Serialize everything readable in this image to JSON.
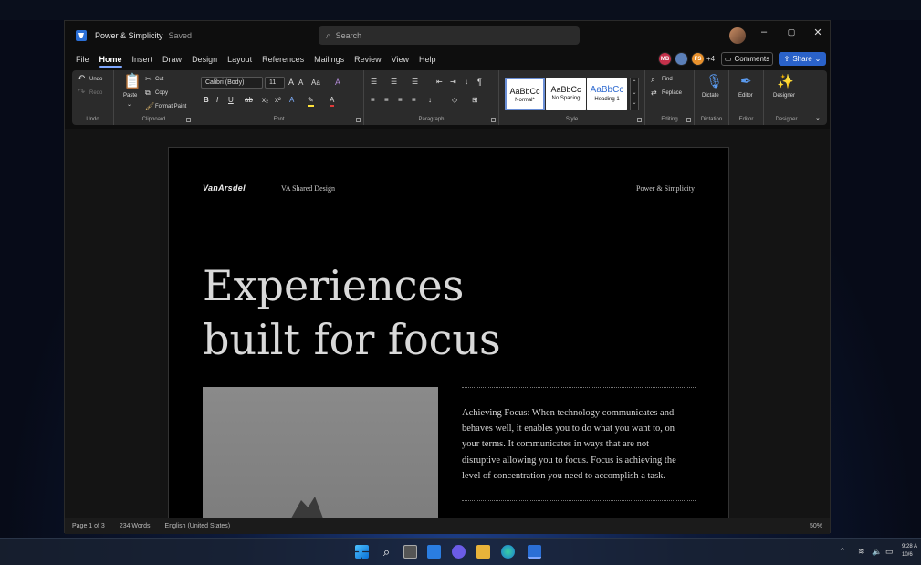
{
  "window": {
    "doc_title": "Power & Simplicity",
    "doc_status": "Saved",
    "search_placeholder": "Search"
  },
  "menu": {
    "tabs": [
      "File",
      "Home",
      "Insert",
      "Draw",
      "Design",
      "Layout",
      "References",
      "Mailings",
      "Review",
      "View",
      "Help"
    ],
    "active": "Home"
  },
  "collaborators": [
    {
      "initials": "MB",
      "color": "#c4314b"
    },
    {
      "initials": "",
      "color": "#5b7fb8"
    },
    {
      "initials": "FS",
      "color": "#e8912d"
    }
  ],
  "collab_more": "+4",
  "buttons": {
    "comments": "Comments",
    "share": "Share"
  },
  "ribbon": {
    "undo": {
      "undo": "Undo",
      "redo": "Redo",
      "label": "Undo"
    },
    "clipboard": {
      "paste": "Paste",
      "cut": "Cut",
      "copy": "Copy",
      "format_paint": "Format Paint",
      "label": "Clipboard"
    },
    "font": {
      "family": "Calibri (Body)",
      "size": "11",
      "label": "Font"
    },
    "paragraph": {
      "label": "Paragraph"
    },
    "styles": {
      "cards": [
        {
          "preview": "AaBbCc",
          "name": "Normal*"
        },
        {
          "preview": "AaBbCc",
          "name": "No Spacing"
        },
        {
          "preview": "AaBbCc",
          "name": "Heading 1"
        }
      ],
      "label": "Style"
    },
    "editing": {
      "find": "Find",
      "replace": "Replace",
      "label": "Editing"
    },
    "dictation": {
      "btn": "Dictate",
      "label": "Dictation"
    },
    "editor": {
      "btn": "Editor",
      "label": "Editor"
    },
    "designer": {
      "btn": "Designer",
      "label": "Designer"
    }
  },
  "page": {
    "logo": "VanArsdel",
    "header": "VA Shared Design",
    "header_right": "Power & Simplicity",
    "title_line1": "Experiences",
    "title_line2": "built for focus",
    "body": "Achieving Focus: When technology communicates and behaves well, it enables you to do what you want to, on your terms. It communicates in ways that are not disruptive allowing you to focus. Focus is achieving the level of concentration you need to accomplish a task."
  },
  "status": {
    "page": "Page 1 of 3",
    "words": "234 Words",
    "language": "English (United States)",
    "zoom": "50%"
  },
  "taskbar": {
    "time": "9:28 A",
    "date": "10/6"
  }
}
